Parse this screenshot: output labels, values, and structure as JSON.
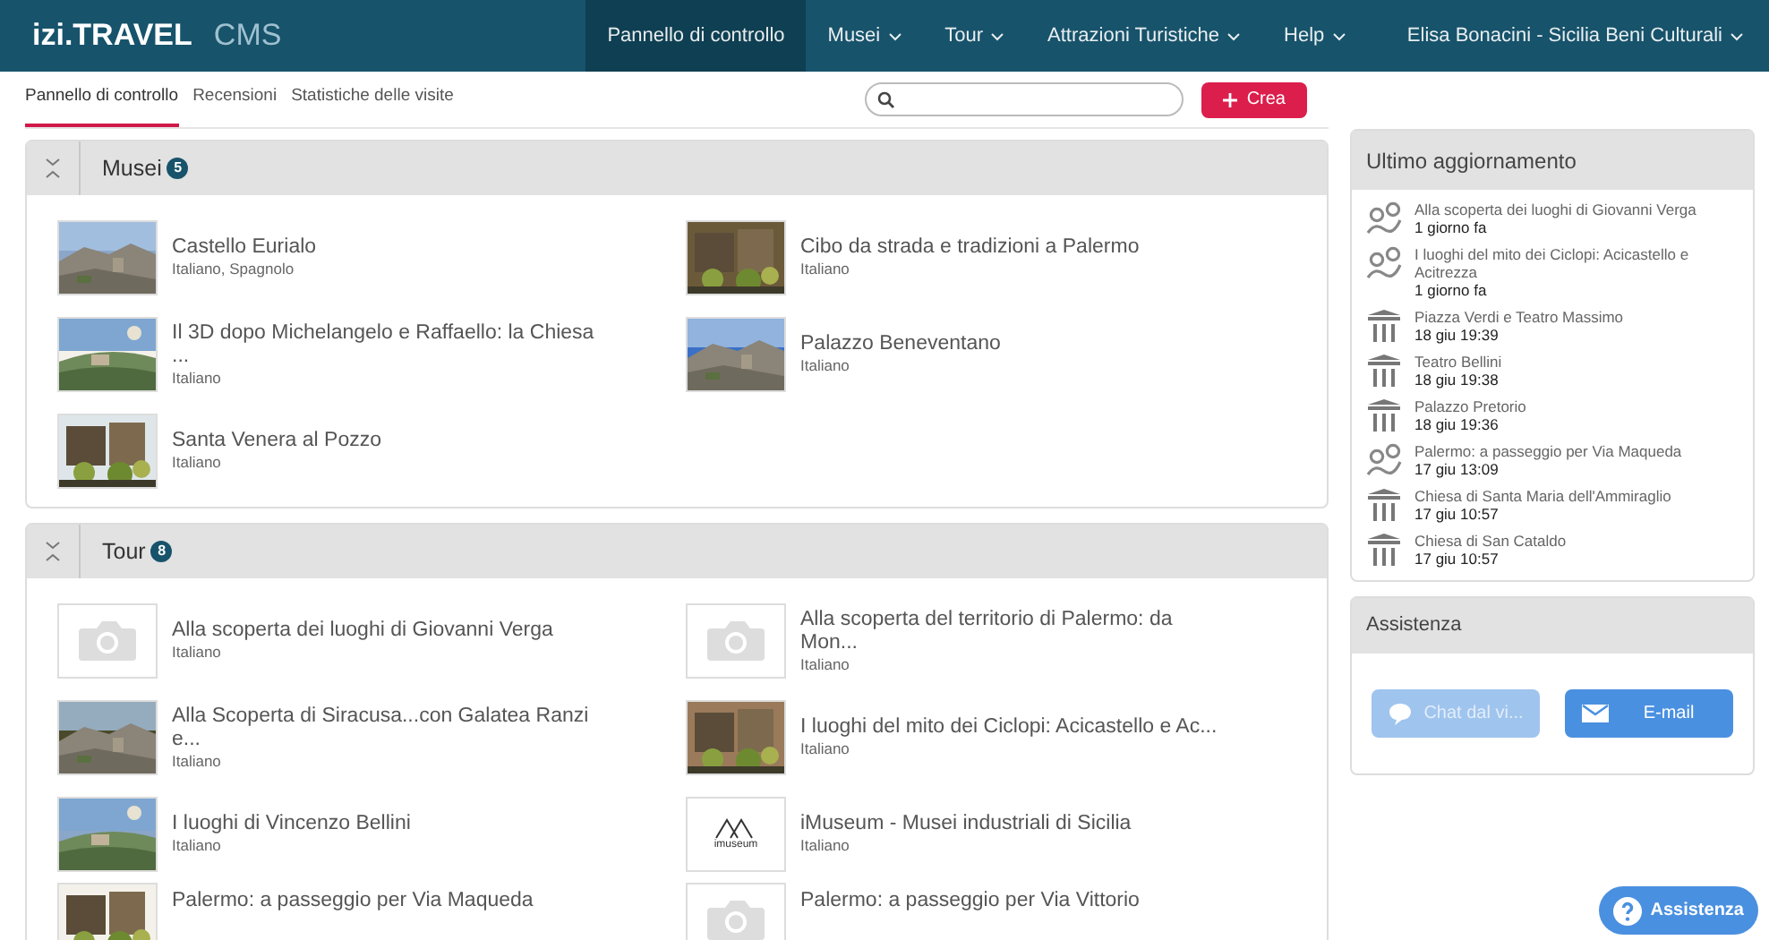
{
  "topbar": {
    "logo": "izi.TRAVEL",
    "product": "CMS",
    "nav": [
      {
        "label": "Pannello di controllo",
        "selected": true,
        "dropdown": false
      },
      {
        "label": "Musei",
        "selected": false,
        "dropdown": true
      },
      {
        "label": "Tour",
        "selected": false,
        "dropdown": true
      },
      {
        "label": "Attrazioni Turistiche",
        "selected": false,
        "dropdown": true
      },
      {
        "label": "Help",
        "selected": false,
        "dropdown": true
      }
    ],
    "user": "Elisa Bonacini - Sicilia Beni Culturali"
  },
  "subnav": {
    "tabs": [
      {
        "label": "Pannello di controllo",
        "selected": true
      },
      {
        "label": "Recensioni",
        "selected": false
      },
      {
        "label": "Statistiche delle visite",
        "selected": false
      }
    ],
    "create_button": "Crea"
  },
  "sections": [
    {
      "title": "Musei",
      "count": "5",
      "expanded": true,
      "items": [
        {
          "title": "Castello Eurialo",
          "languages": "Italiano, Spagnolo",
          "kind": "picture"
        },
        {
          "title": "Cibo da strada e tradizioni a Palermo",
          "languages": "Italiano",
          "kind": "picture"
        },
        {
          "title": "Il 3D dopo Michelangelo e Raffaello: la Chiesa ...",
          "languages": "Italiano",
          "kind": "picture"
        },
        {
          "title": "Palazzo Beneventano",
          "languages": "Italiano",
          "kind": "picture"
        },
        {
          "title": "Santa Venera al Pozzo",
          "languages": "Italiano",
          "kind": "picture"
        }
      ]
    },
    {
      "title": "Tour",
      "count": "8",
      "expanded": true,
      "items": [
        {
          "title": "Alla scoperta dei luoghi di Giovanni Verga",
          "languages": "Italiano",
          "kind": "camera"
        },
        {
          "title": "Alla scoperta del territorio di Palermo: da Mon...",
          "languages": "Italiano",
          "kind": "camera"
        },
        {
          "title": "Alla Scoperta di Siracusa...con Galatea Ranzi e...",
          "languages": "Italiano",
          "kind": "picture"
        },
        {
          "title": "I luoghi del mito dei Ciclopi: Acicastello e Ac...",
          "languages": "Italiano",
          "kind": "picture"
        },
        {
          "title": "I luoghi di Vincenzo Bellini",
          "languages": "Italiano",
          "kind": "picture"
        },
        {
          "title": "iMuseum - Musei industriali di Sicilia",
          "languages": "Italiano",
          "kind": "logo",
          "logo_text": "imuseum"
        },
        {
          "title": "Palermo: a passeggio per Via Maqueda",
          "kind": "picture"
        },
        {
          "title": "Palermo: a passeggio per Via Vittorio",
          "kind": "camera"
        }
      ]
    }
  ],
  "updates": {
    "title": "Ultimo aggiornamento",
    "items": [
      {
        "kind": "tour",
        "title": "Alla scoperta dei luoghi di Giovanni Verga",
        "time": "1 giorno fa"
      },
      {
        "kind": "tour",
        "title": "I luoghi del mito dei Ciclopi: Acicastello e Acitrezza",
        "time": "1 giorno fa"
      },
      {
        "kind": "place",
        "title": "Piazza Verdi e Teatro Massimo",
        "time": "18 giu 19:39"
      },
      {
        "kind": "place",
        "title": "Teatro Bellini",
        "time": "18 giu 19:38"
      },
      {
        "kind": "place",
        "title": "Palazzo Pretorio",
        "time": "18 giu 19:36"
      },
      {
        "kind": "tour",
        "title": "Palermo: a passeggio per Via Maqueda",
        "time": "17 giu 13:09"
      },
      {
        "kind": "place",
        "title": "Chiesa di Santa Maria dell'Ammiraglio",
        "time": "17 giu 10:57"
      },
      {
        "kind": "place",
        "title": "Chiesa di San Cataldo",
        "time": "17 giu 10:57"
      }
    ]
  },
  "support": {
    "title": "Assistenza",
    "buttons": [
      {
        "label": "Chat dal vi...",
        "kind": "chat",
        "disabled": true
      },
      {
        "label": "E-mail",
        "kind": "email",
        "disabled": false
      }
    ],
    "floating_button": "Assistenza"
  }
}
